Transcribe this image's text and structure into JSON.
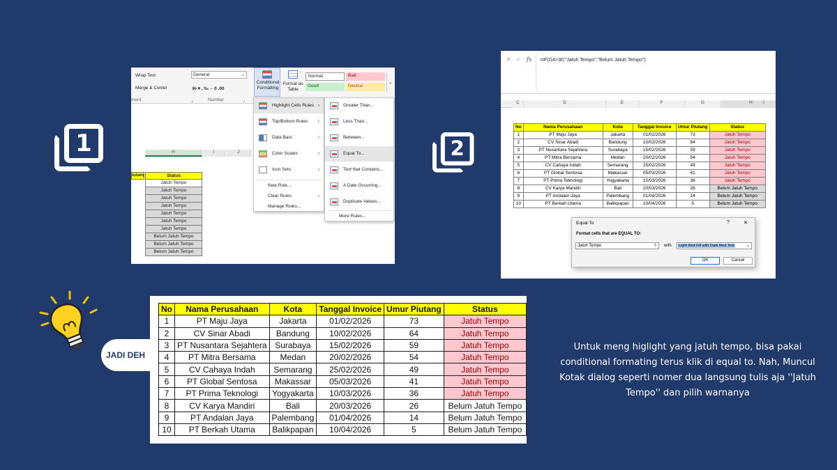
{
  "step1_number": "1",
  "step2_number": "2",
  "shot1": {
    "wrap_text": "Wrap Text",
    "merge_center": "Merge & Center",
    "number_format": "General",
    "number_group": "Number",
    "alignment_group": "ment",
    "conditional_formatting": "Conditional Formatting",
    "format_as_table": "Format as Table",
    "styles": {
      "normal": "Normal",
      "bad": "Bad",
      "good": "Good",
      "neutral": "Neutral"
    },
    "columns": [
      "H",
      "I",
      "J"
    ],
    "header_left": "iutang",
    "header_status": "Status",
    "status_values": [
      "Jatuh Tempo",
      "Jatuh Tempo",
      "Jatuh Tempo",
      "Jatuh Tempo",
      "Jatuh Tempo",
      "Jatuh Tempo",
      "Jatuh Tempo",
      "Belum Jatuh Tempo",
      "Belum Jatuh Tempo",
      "Belum Jatuh Tempo"
    ],
    "menu": [
      "Highlight Cells Rules",
      "Top/Bottom Rules",
      "Data Bars",
      "Color Scales",
      "Icon Sets",
      "New Rule...",
      "Clear Rules",
      "Manage Rules..."
    ],
    "submenu": [
      "Greater Than...",
      "Less Than...",
      "Between...",
      "Equal To...",
      "Text that Contains...",
      "A Date Occurring...",
      "Duplicate Values...",
      "More Rules..."
    ]
  },
  "shot2": {
    "formula": "=IF(G4>30;\"Jatuh Tempo\";\"Belum Jatuh Tempo\")",
    "fx": "fx",
    "columns": [
      "C",
      "D",
      "E",
      "F",
      "G",
      "H",
      "I"
    ],
    "dialog_title": "Equal To",
    "dialog_prompt": "Format cells that are EQUAL TO:",
    "dialog_value": "Jatuh Tempo",
    "dialog_with": "with",
    "dialog_format": "Light Red Fill with Dark Red Text",
    "ok": "OK",
    "cancel": "Cancel",
    "help": "?",
    "close": "✕"
  },
  "table": {
    "headers": [
      "No",
      "Nama Perusahaan",
      "Kota",
      "Tanggal Invoice",
      "Umur Piutang",
      "Status"
    ],
    "rows": [
      [
        "1",
        "PT Maju Jaya",
        "Jakarta",
        "01/02/2026",
        "73",
        "Jatuh Tempo"
      ],
      [
        "2",
        "CV Sinar Abadi",
        "Bandung",
        "10/02/2026",
        "64",
        "Jatuh Tempo"
      ],
      [
        "3",
        "PT Nusantara Sejahtera",
        "Surabaya",
        "15/02/2026",
        "59",
        "Jatuh Tempo"
      ],
      [
        "4",
        "PT Mitra Bersama",
        "Medan",
        "20/02/2026",
        "54",
        "Jatuh Tempo"
      ],
      [
        "5",
        "CV Cahaya Indah",
        "Semarang",
        "25/02/2026",
        "49",
        "Jatuh Tempo"
      ],
      [
        "6",
        "PT Global Sentosa",
        "Makassar",
        "05/03/2026",
        "41",
        "Jatuh Tempo"
      ],
      [
        "7",
        "PT Prima Teknologi",
        "Yogyakarta",
        "10/03/2026",
        "36",
        "Jatuh Tempo"
      ],
      [
        "8",
        "CV Karya Mandiri",
        "Bali",
        "20/03/2026",
        "26",
        "Belum Jatuh Tempo"
      ],
      [
        "9",
        "PT Andalan Jaya",
        "Palembang",
        "01/04/2026",
        "14",
        "Belum Jatuh Tempo"
      ],
      [
        "10",
        "PT Berkah Utama",
        "Balikpapan",
        "10/04/2026",
        "5",
        "Belum Jatuh Tempo"
      ]
    ]
  },
  "jadi_deh": "JADI DEH",
  "description": "Untuk meng higlight yang jatuh tempo, bisa pakai conditional formating terus klik di equal to. Nah, Muncul Kotak dialog seperti nomer dua langsung tulis aja ''Jatuh Tempo'' dan pilih warnanya",
  "colors": {
    "background": "#1f3a6b",
    "header_yellow": "#ffff00",
    "red_fill": "#ffc7ce",
    "red_text": "#9c0006",
    "grey_fill": "#d9d9d9"
  }
}
